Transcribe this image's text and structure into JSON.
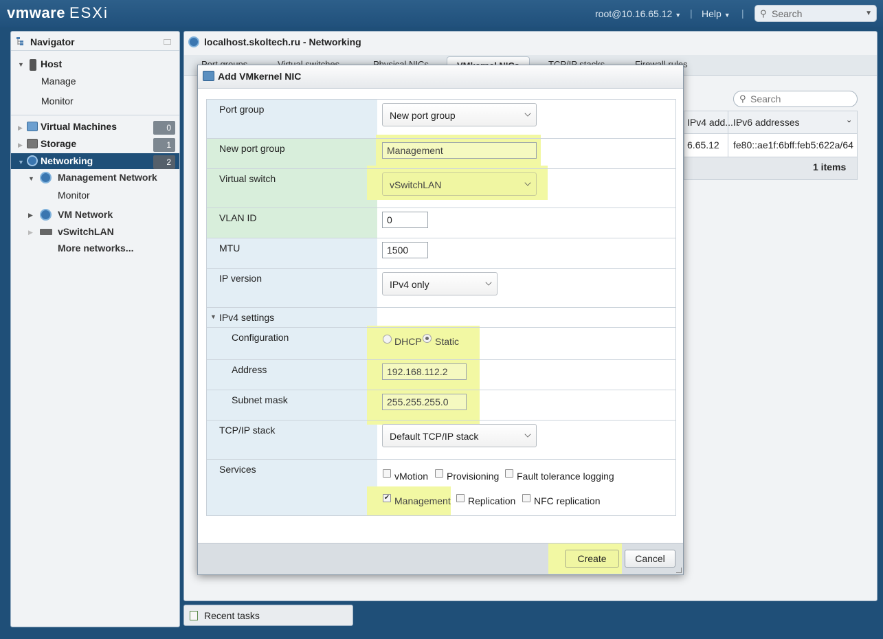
{
  "topbar": {
    "brand_vm": "vmware",
    "brand_esxi": "ESXi",
    "user": "root@10.16.65.12",
    "help": "Help",
    "search_placeholder": "Search"
  },
  "navigator": {
    "title": "Navigator",
    "host": "Host",
    "manage": "Manage",
    "monitor": "Monitor",
    "items": [
      {
        "label": "Virtual Machines",
        "count": "0"
      },
      {
        "label": "Storage",
        "count": "1"
      },
      {
        "label": "Networking",
        "count": "2"
      }
    ],
    "networks": {
      "management_network": "Management Network",
      "monitor": "Monitor",
      "vm_network": "VM Network",
      "vswitchlan": "vSwitchLAN",
      "more": "More networks..."
    }
  },
  "main": {
    "title": "localhost.skoltech.ru - Networking",
    "tabs": [
      "Port groups",
      "Virtual switches",
      "Physical NICs",
      "VMkernel NICs",
      "TCP/IP stacks",
      "Firewall rules"
    ],
    "active_tab": "VMkernel NICs",
    "search_placeholder": "Search",
    "table": {
      "col_ipv4": "IPv4 add...",
      "col_ipv6": "IPv6 addresses",
      "row_ipv4": "6.65.12",
      "row_ipv6": "fe80::ae1f:6bff:feb5:622a/64",
      "footer": "1 items"
    }
  },
  "recent_tasks": "Recent tasks",
  "modal": {
    "title": "Add VMkernel NIC",
    "labels": {
      "port_group": "Port group",
      "new_port_group": "New port group",
      "virtual_switch": "Virtual switch",
      "vlan_id": "VLAN ID",
      "mtu": "MTU",
      "ip_version": "IP version",
      "ipv4_settings": "IPv4 settings",
      "configuration": "Configuration",
      "address": "Address",
      "subnet_mask": "Subnet mask",
      "tcpip_stack": "TCP/IP stack",
      "services": "Services"
    },
    "values": {
      "port_group": "New port group",
      "new_port_group": "Management",
      "virtual_switch": "vSwitchLAN",
      "vlan_id": "0",
      "mtu": "1500",
      "ip_version": "IPv4 only",
      "config_dhcp": "DHCP",
      "config_static": "Static",
      "address": "192.168.112.2",
      "subnet_mask": "255.255.255.0",
      "tcpip_stack": "Default TCP/IP stack"
    },
    "services": {
      "vmotion": "vMotion",
      "provisioning": "Provisioning",
      "ft_logging": "Fault tolerance logging",
      "management": "Management",
      "replication": "Replication",
      "nfc_replication": "NFC replication"
    },
    "buttons": {
      "create": "Create",
      "cancel": "Cancel"
    }
  },
  "colors": {
    "accent": "#1f4f78",
    "highlight": "#f2f8a3"
  }
}
